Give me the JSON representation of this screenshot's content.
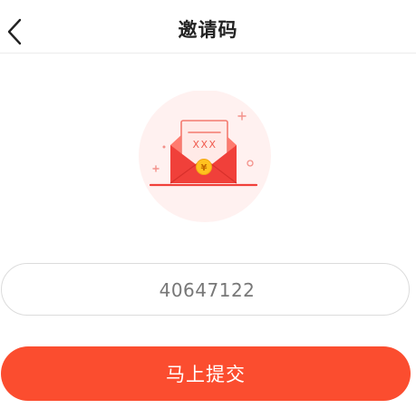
{
  "header": {
    "title": "邀请码",
    "back_icon": "chevron-left-icon"
  },
  "illustration": {
    "icon": "red-envelope-invitation-icon",
    "card_text": "XXX",
    "coin_symbol": "¥",
    "colors": {
      "circle_bg": "#fff1f0",
      "envelope": "#f0403a",
      "envelope_flap": "#ff6b5e",
      "card": "#ffe9e6",
      "card_stroke": "#f47a6f",
      "coin": "#ffc21f"
    }
  },
  "form": {
    "invite_code_value": "40647122",
    "invite_code_placeholder": "",
    "submit_label": "马上提交"
  },
  "colors": {
    "accent": "#fb4d2f",
    "input_border": "#dcdcdc",
    "title_text": "#222222",
    "input_text": "#777777"
  }
}
